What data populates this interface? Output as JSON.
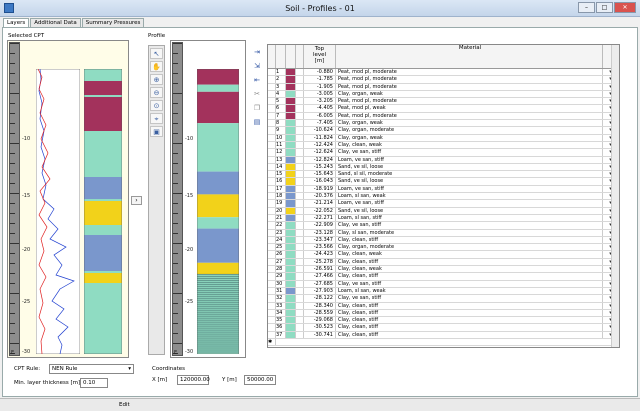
{
  "window": {
    "title": "Soil - Profiles - 01",
    "buttons": [
      "–",
      "□",
      "✕"
    ]
  },
  "tabs": [
    "Layers",
    "Additional Data",
    "Summary Pressures"
  ],
  "labels": {
    "selected_cpt": "Selected CPT",
    "profile": "Profile",
    "cpt_rule": "CPT Rule:",
    "min_thickness": "Min. layer thickness [m]",
    "coordinates": "Coordinates",
    "x_label": "X  [m]",
    "y_label": "Y  [m]",
    "edit": "Edit",
    "E": "E"
  },
  "fields": {
    "cpt_rule": "NEN Rule",
    "min_thickness": "0.10",
    "x": "120000.00",
    "y": "50000.00"
  },
  "ruler_ticks": [
    "-5",
    "-10",
    "-15",
    "-20",
    "-25",
    "-30"
  ],
  "grid": {
    "headers": {
      "top_level": "Top\nlevel\n[m]",
      "material": "Material"
    },
    "rows": [
      {
        "n": "1",
        "top": "-0.880",
        "material": "Peat, mod pl, moderate",
        "color": "#a3325c"
      },
      {
        "n": "2",
        "top": "-1.785",
        "material": "Peat, mod pl, moderate",
        "color": "#a3325c"
      },
      {
        "n": "3",
        "top": "-1.905",
        "material": "Peat, mod pl, moderate",
        "color": "#a3325c"
      },
      {
        "n": "4",
        "top": "-3.005",
        "material": "Clay, organ, weak",
        "color": "#8fdcc2"
      },
      {
        "n": "5",
        "top": "-3.205",
        "material": "Peat, mod pl, moderate",
        "color": "#a3325c"
      },
      {
        "n": "6",
        "top": "-4.405",
        "material": "Peat, mod pl, weak",
        "color": "#a3325c"
      },
      {
        "n": "7",
        "top": "-6.005",
        "material": "Peat, mod pl, moderate",
        "color": "#a3325c"
      },
      {
        "n": "8",
        "top": "-7.405",
        "material": "Clay, organ, weak",
        "color": "#8fdcc2"
      },
      {
        "n": "9",
        "top": "-10.624",
        "material": "Clay, organ, moderate",
        "color": "#8fdcc2"
      },
      {
        "n": "10",
        "top": "-11.824",
        "material": "Clay, organ, weak",
        "color": "#8fdcc2"
      },
      {
        "n": "11",
        "top": "-12.424",
        "material": "Clay, clean, weak",
        "color": "#8fdcc2"
      },
      {
        "n": "12",
        "top": "-12.624",
        "material": "Clay, ve san, stiff",
        "color": "#8fdcc2"
      },
      {
        "n": "13",
        "top": "-12.824",
        "material": "Loam, ve san, stiff",
        "color": "#7a97cc"
      },
      {
        "n": "14",
        "top": "-15.243",
        "material": "Sand, ve sil, loose",
        "color": "#f2d21a"
      },
      {
        "n": "15",
        "top": "-15.643",
        "material": "Sand, sl sil, moderate",
        "color": "#f2d21a"
      },
      {
        "n": "16",
        "top": "-16.043",
        "material": "Sand, ve sil, loose",
        "color": "#f2d21a"
      },
      {
        "n": "17",
        "top": "-18.919",
        "material": "Loam, ve san, stiff",
        "color": "#7a97cc"
      },
      {
        "n": "18",
        "top": "-20.376",
        "material": "Loam, sl san, weak",
        "color": "#7a97cc"
      },
      {
        "n": "19",
        "top": "-21.214",
        "material": "Loam, ve san, stiff",
        "color": "#7a97cc"
      },
      {
        "n": "20",
        "top": "-22.052",
        "material": "Sand, ve sil, loose",
        "color": "#f2d21a"
      },
      {
        "n": "21",
        "top": "-22.271",
        "material": "Loam, sl san, stiff",
        "color": "#7a97cc"
      },
      {
        "n": "22",
        "top": "-22.909",
        "material": "Clay, ve san, stiff",
        "color": "#8fdcc2"
      },
      {
        "n": "23",
        "top": "-23.128",
        "material": "Clay, sl san, moderate",
        "color": "#8fdcc2"
      },
      {
        "n": "24",
        "top": "-23.347",
        "material": "Clay, clean, stiff",
        "color": "#8fdcc2"
      },
      {
        "n": "25",
        "top": "-23.566",
        "material": "Clay, organ, moderate",
        "color": "#8fdcc2"
      },
      {
        "n": "26",
        "top": "-24.423",
        "material": "Clay, clean, weak",
        "color": "#8fdcc2"
      },
      {
        "n": "27",
        "top": "-25.278",
        "material": "Clay, clean, stiff",
        "color": "#8fdcc2"
      },
      {
        "n": "28",
        "top": "-26.591",
        "material": "Clay, clean, weak",
        "color": "#8fdcc2"
      },
      {
        "n": "29",
        "top": "-27.466",
        "material": "Clay, clean, stiff",
        "color": "#8fdcc2"
      },
      {
        "n": "30",
        "top": "-27.685",
        "material": "Clay, ve san, stiff",
        "color": "#8fdcc2"
      },
      {
        "n": "31",
        "top": "-27.903",
        "material": "Loam, sl san, weak",
        "color": "#7a97cc"
      },
      {
        "n": "32",
        "top": "-28.122",
        "material": "Clay, ve san, stiff",
        "color": "#8fdcc2"
      },
      {
        "n": "33",
        "top": "-28.340",
        "material": "Clay, clean, stiff",
        "color": "#8fdcc2"
      },
      {
        "n": "34",
        "top": "-28.559",
        "material": "Clay, clean, stiff",
        "color": "#8fdcc2"
      },
      {
        "n": "35",
        "top": "-29.068",
        "material": "Clay, clean, stiff",
        "color": "#8fdcc2"
      },
      {
        "n": "36",
        "top": "-30.523",
        "material": "Clay, clean, stiff",
        "color": "#8fdcc2"
      },
      {
        "n": "37",
        "top": "-30.741",
        "material": "Clay, clean, stiff",
        "color": "#8fdcc2"
      }
    ],
    "new_row_marker": "✱"
  },
  "profile_bands": [
    {
      "from": 0.0,
      "to": 0.055,
      "color": "#a3325c"
    },
    {
      "from": 0.055,
      "to": 0.08,
      "color": "#8fdcc2"
    },
    {
      "from": 0.08,
      "to": 0.19,
      "color": "#a3325c"
    },
    {
      "from": 0.19,
      "to": 0.36,
      "color": "#8fdcc2"
    },
    {
      "from": 0.36,
      "to": 0.44,
      "color": "#7a97cc"
    },
    {
      "from": 0.44,
      "to": 0.52,
      "color": "#f2d21a"
    },
    {
      "from": 0.52,
      "to": 0.56,
      "color": "#8fdcc2"
    },
    {
      "from": 0.56,
      "to": 0.68,
      "color": "#7a97cc"
    },
    {
      "from": 0.68,
      "to": 0.72,
      "color": "#f2d21a"
    },
    {
      "from": 0.72,
      "to": 1.0,
      "color": "#8fdcc2"
    }
  ],
  "colors": {
    "peat": "#a3325c",
    "clay": "#8fdcc2",
    "loam": "#7a97cc",
    "sand": "#f2d21a",
    "cpt_bg": "#fffde8"
  },
  "icons": {
    "pointer": "pointer-icon",
    "hand": "pan-icon",
    "zoom_in": "zoom-in-icon",
    "zoom_out": "zoom-out-icon",
    "fit": "zoom-fit-icon",
    "measure": "measure-icon",
    "save": "save-icon",
    "insert": "insert-row-icon",
    "add": "add-row-icon",
    "delete": "delete-row-icon",
    "cut": "cut-icon",
    "copy": "copy-icon",
    "paste": "paste-icon"
  }
}
